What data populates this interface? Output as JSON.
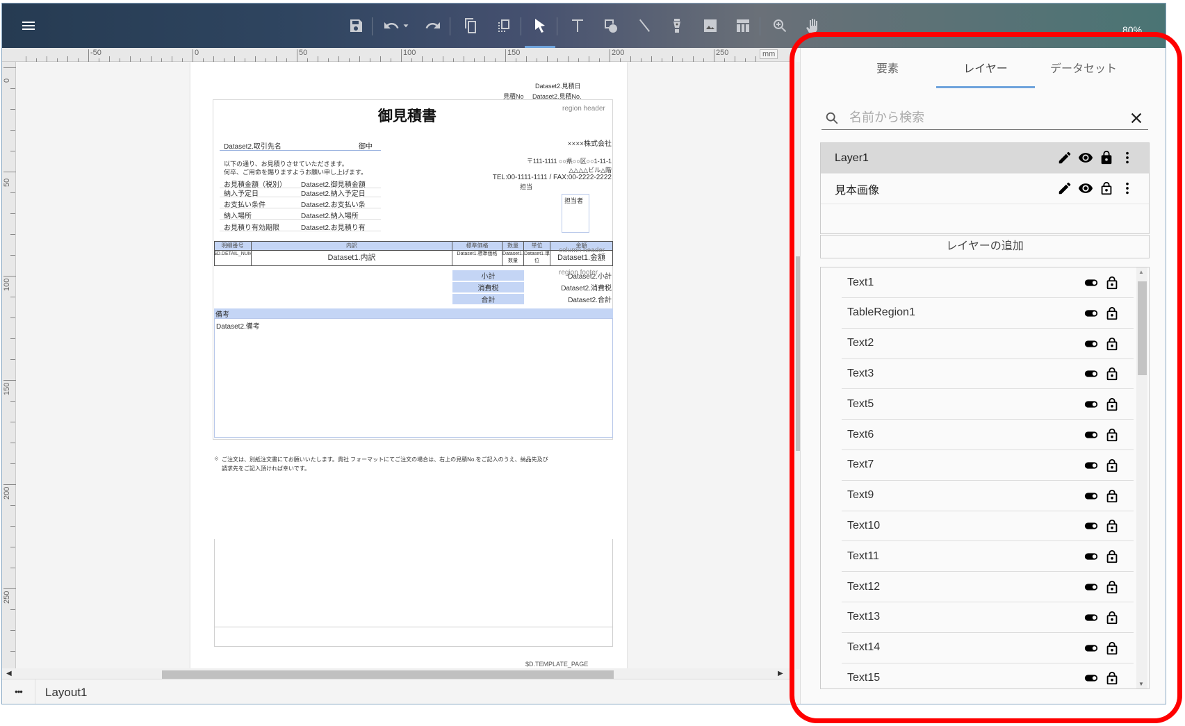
{
  "toolbar": {
    "zoom_level": "80%",
    "icons": [
      "menu-icon",
      "save-icon",
      "undo-icon",
      "undo-dropdown-icon",
      "redo-icon",
      "copy-icon",
      "duplicate-icon",
      "select-icon",
      "text-tool-icon",
      "shape-tool-icon",
      "line-tool-icon",
      "pen-tool-icon",
      "image-tool-icon",
      "table-tool-icon",
      "zoom-tool-icon",
      "hand-tool-icon"
    ]
  },
  "ruler": {
    "unit": "mm",
    "h_labels": [
      "-50",
      "0",
      "50",
      "100",
      "150",
      "200",
      "250"
    ],
    "v_labels": [
      "0",
      "50",
      "100",
      "150",
      "200",
      "250"
    ]
  },
  "document": {
    "estimate_date": "Dataset2.見積日",
    "estimate_no_label": "見積No",
    "estimate_no": "Dataset2.見積No.",
    "region_header": "region header",
    "title": "御見積書",
    "client": "Dataset2.取引先名",
    "honorific": "御中",
    "company": "××××株式会社",
    "intro1": "以下の通り、お見積りさせていただきます。",
    "intro2": "何卒、ご用命を賜りますようお願い申し上げます。",
    "address1": "〒111-1111 ○○県○○区○○1-11-1",
    "address2": "△△△△ビル△階",
    "tel": "TEL:00-1111-1111 / FAX:00-2222-2222",
    "staff_label": "担当",
    "staff_box": "担当者",
    "info_rows": [
      {
        "label": "お見積金額（税別）",
        "value": "Dataset2.御見積金額"
      },
      {
        "label": "納入予定日",
        "value": "Dataset2.納入予定日"
      },
      {
        "label": "お支払い条件",
        "value": "Dataset2.お支払い条"
      },
      {
        "label": "納入場所",
        "value": "Dataset2.納入場所"
      },
      {
        "label": "お見積り有効期限",
        "value": "Dataset2.お見積り有"
      }
    ],
    "table_headers": [
      "明細番号",
      "内訳",
      "標準価格",
      "数量",
      "単位",
      "金額"
    ],
    "column_header": "column header",
    "table_row": [
      "$D.DETAIL_NUMBER",
      "Dataset1.内訳",
      "Dataset1.標準価格",
      "Dataset1.数量",
      "Dataset1.単位",
      "Dataset1.金額"
    ],
    "region_footer": "region footer",
    "totals": [
      {
        "label": "小計",
        "value": "Dataset2.小計"
      },
      {
        "label": "消費税",
        "value": "Dataset2.消費税"
      },
      {
        "label": "合計",
        "value": "Dataset2.合計"
      }
    ],
    "remarks_label": "備考",
    "remarks": "Dataset2.備考",
    "note_mark": "※",
    "note1": "ご注文は、別紙注文書にてお願いいたします。貴社 フォーマットにてご注文の場合は、右上の見積No.をご記入のうえ、納品先及び",
    "note2": "請求先をご記入頂ければ幸いです。",
    "template_page": "$D.TEMPLATE_PAGE"
  },
  "footer": {
    "layout_tab": "Layout1",
    "more_label": "•••"
  },
  "panel": {
    "tabs": [
      {
        "label": "要素"
      },
      {
        "label": "レイヤー",
        "active": true
      },
      {
        "label": "データセット"
      }
    ],
    "search_placeholder": "名前から検索",
    "layers": [
      {
        "name": "Layer1",
        "selected": true,
        "locked": true
      },
      {
        "name": "見本画像",
        "selected": false,
        "locked": false
      }
    ],
    "add_layer": "レイヤーの追加",
    "elements": [
      "Text1",
      "TableRegion1",
      "Text2",
      "Text3",
      "Text5",
      "Text6",
      "Text7",
      "Text9",
      "Text10",
      "Text11",
      "Text12",
      "Text13",
      "Text14",
      "Text15"
    ]
  },
  "colors": {
    "accent": "#6fa3dc",
    "highlight": "#ff0000",
    "table_blue": "#c4d5f5"
  }
}
